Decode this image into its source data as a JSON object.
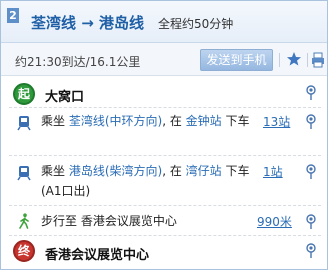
{
  "route": {
    "number": "2",
    "title": "荃湾线 → 港岛线",
    "total": "全程约50分钟"
  },
  "info": {
    "arrival": "约21:30到达/16.1公里",
    "send_label": "发送到手机"
  },
  "start": {
    "marker": "起",
    "place": "大窝口"
  },
  "steps": [
    {
      "prefix": "乘坐 ",
      "line": "荃湾线(中环方向)",
      "mid": ", 在 ",
      "station": "金钟站",
      "suffix": " 下车",
      "count": "13站"
    },
    {
      "prefix": "乘坐 ",
      "line": "港岛线(柴湾方向)",
      "mid": ", 在 ",
      "station": "湾仔站",
      "suffix": " 下车(A1口出)",
      "count": "1站"
    },
    {
      "text": "步行至 香港会议展览中心",
      "count": "990米"
    }
  ],
  "end": {
    "marker": "终",
    "place": "香港会议展览中心"
  },
  "icons": {
    "star": "star-icon",
    "print": "printer-icon",
    "subway": "subway-icon",
    "walk": "walk-icon",
    "pin": "location-pin-icon"
  },
  "colors": {
    "accent": "#2a6cb5",
    "start": "#2f9a3c",
    "end": "#c8352e",
    "walk": "#3ea33a"
  }
}
